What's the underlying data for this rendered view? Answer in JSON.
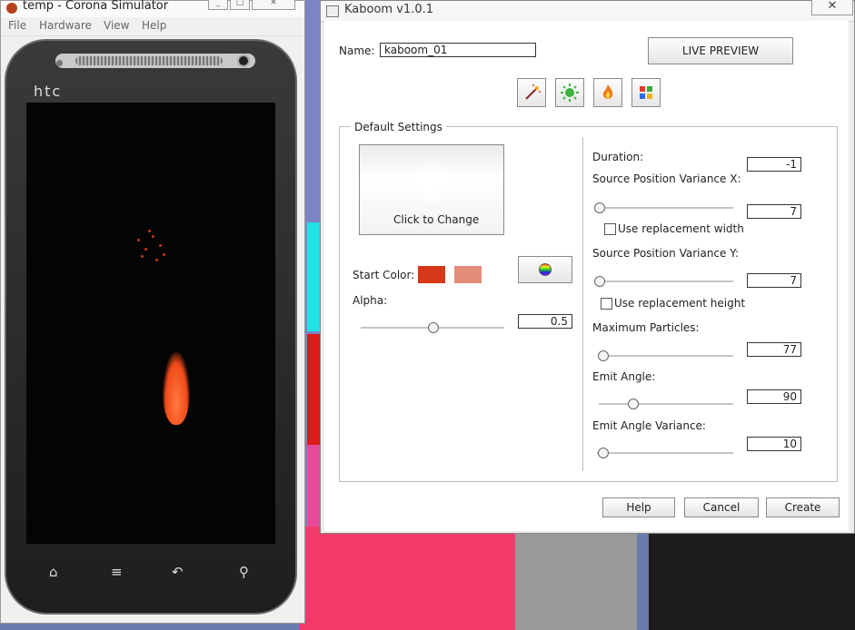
{
  "simulator": {
    "title": "temp - Corona Simulator",
    "menu": [
      "File",
      "Hardware",
      "View",
      "Help"
    ],
    "brand": "htc",
    "nav_keys": [
      "⌂",
      "≡",
      "↶",
      "⚲"
    ]
  },
  "kaboom": {
    "title": "Kaboom v1.0.1",
    "close_label": "✕",
    "name_label": "Name:",
    "name_value": "kaboom_01",
    "live_preview_label": "LIVE PREVIEW",
    "toolbar_icons": [
      "magic-wand-icon",
      "sun-icon",
      "fire-icon",
      "color-grid-icon"
    ],
    "group_title": "Default Settings",
    "texture_label": "Click to Change",
    "start_color_label": "Start Color:",
    "start_colors": [
      "#d63818",
      "#e48c7c"
    ],
    "alpha_label": "Alpha:",
    "alpha_value": "0.5",
    "alpha_fraction": 0.5,
    "duration_label": "Duration:",
    "duration_value": "-1",
    "spvx_label": "Source Position Variance X:",
    "spvx_value": "7",
    "use_width_label": "Use replacement width",
    "spvy_label": "Source Position Variance Y:",
    "spvy_value": "7",
    "use_height_label": "Use replacement height",
    "max_particles_label": "Maximum Particles:",
    "max_particles_value": "77",
    "emit_angle_label": "Emit Angle:",
    "emit_angle_value": "90",
    "emit_angle_var_label": "Emit Angle Variance:",
    "emit_angle_var_value": "10",
    "help_label": "Help",
    "cancel_label": "Cancel",
    "create_label": "Create"
  }
}
